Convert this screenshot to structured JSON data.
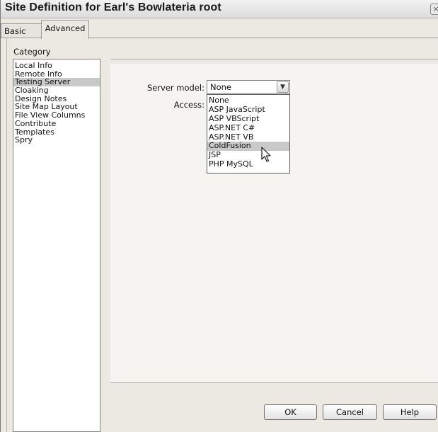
{
  "window": {
    "title": "Site Definition for Earl's Bowlateria root",
    "close_glyph": "×"
  },
  "tabs": [
    {
      "label": "Basic",
      "active": false
    },
    {
      "label": "Advanced",
      "active": true
    }
  ],
  "category": {
    "label": "Category",
    "items": [
      {
        "label": "Local Info",
        "selected": false
      },
      {
        "label": "Remote Info",
        "selected": false
      },
      {
        "label": "Testing Server",
        "selected": true
      },
      {
        "label": "Cloaking",
        "selected": false
      },
      {
        "label": "Design Notes",
        "selected": false
      },
      {
        "label": "Site Map Layout",
        "selected": false
      },
      {
        "label": "File View Columns",
        "selected": false
      },
      {
        "label": "Contribute",
        "selected": false
      },
      {
        "label": "Templates",
        "selected": false
      },
      {
        "label": "Spry",
        "selected": false
      }
    ]
  },
  "form": {
    "server_model_label": "Server model:",
    "server_model_value": "None",
    "access_label": "Access:",
    "dropdown_options": [
      {
        "label": "None",
        "highlighted": false
      },
      {
        "label": "ASP JavaScript",
        "highlighted": false
      },
      {
        "label": "ASP VBScript",
        "highlighted": false
      },
      {
        "label": "ASP.NET C#",
        "highlighted": false
      },
      {
        "label": "ASP.NET VB",
        "highlighted": false
      },
      {
        "label": "ColdFusion",
        "highlighted": true
      },
      {
        "label": "JSP",
        "highlighted": false
      },
      {
        "label": "PHP MySQL",
        "highlighted": false
      }
    ],
    "arrow_glyph": "▼"
  },
  "buttons": {
    "ok": "OK",
    "cancel": "Cancel",
    "help": "Help"
  },
  "icons": {
    "close": "close-icon",
    "dropdown_arrow": "chevron-down-icon",
    "cursor": "mouse-pointer-icon"
  }
}
